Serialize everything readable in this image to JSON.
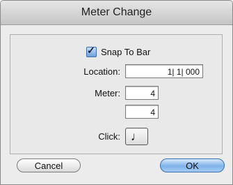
{
  "window": {
    "title": "Meter Change"
  },
  "snap": {
    "label": "Snap To Bar",
    "checked": true
  },
  "location": {
    "label": "Location:",
    "value": "1| 1| 000"
  },
  "meter": {
    "label": "Meter:",
    "numerator": "4",
    "denominator": "4"
  },
  "click": {
    "label": "Click:",
    "value": "♩"
  },
  "buttons": {
    "cancel": "Cancel",
    "ok": "OK"
  }
}
